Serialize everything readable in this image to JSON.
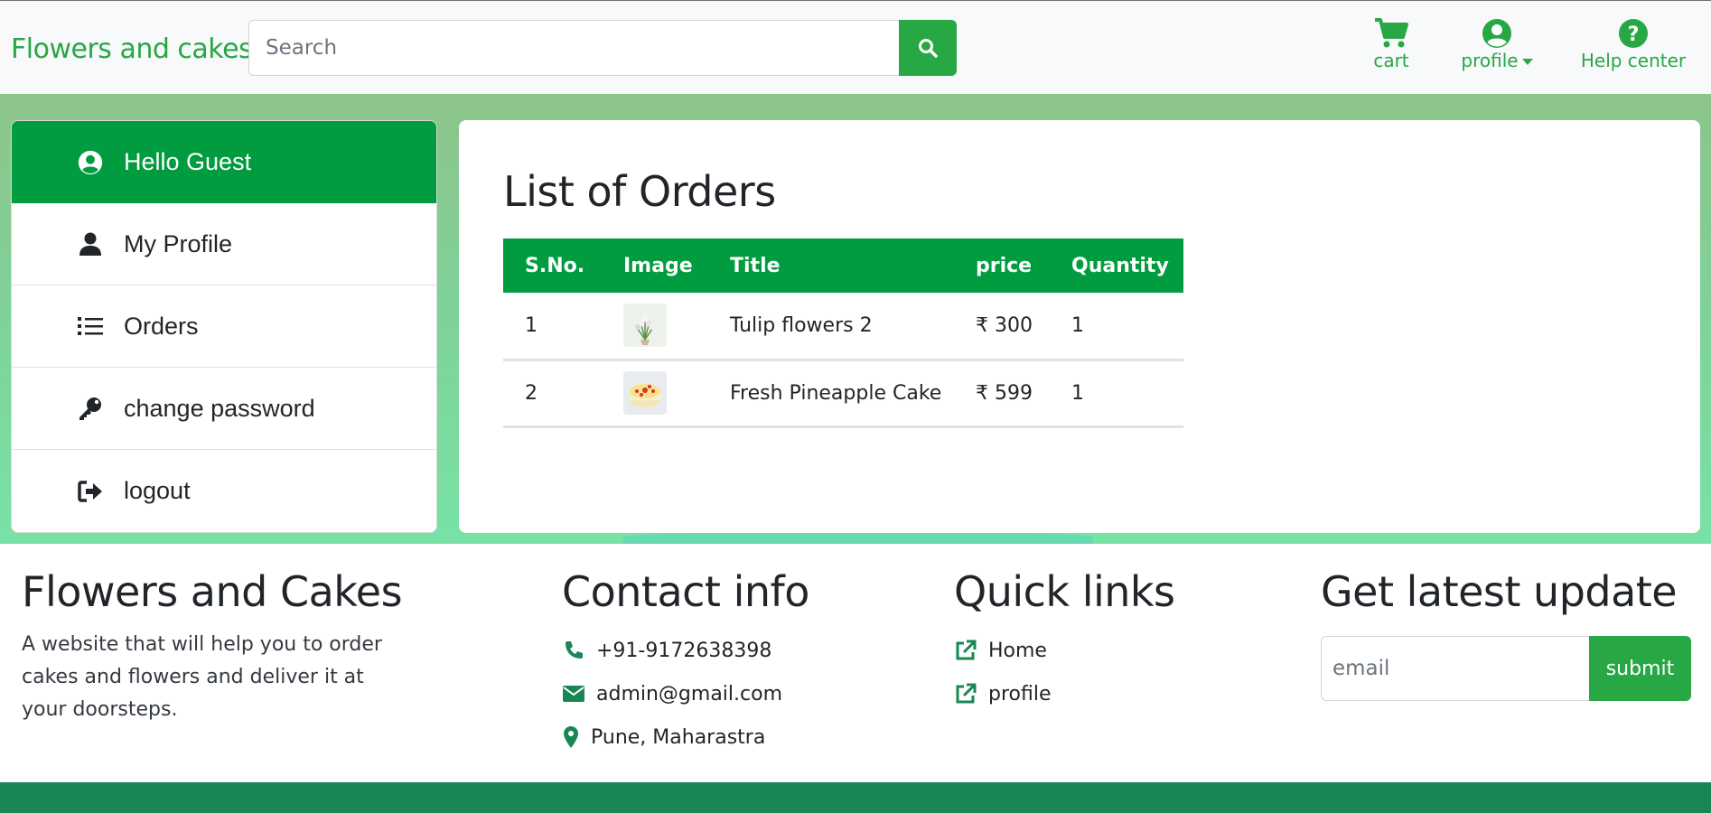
{
  "brand": "Flowers and cakes",
  "search": {
    "placeholder": "Search"
  },
  "nav": {
    "cart": "cart",
    "profile": "profile",
    "help": "Help center"
  },
  "sidebar": {
    "items": [
      {
        "label": "Hello Guest",
        "icon": "user-circle-icon",
        "active": true
      },
      {
        "label": "My Profile",
        "icon": "user-icon"
      },
      {
        "label": "Orders",
        "icon": "list-icon"
      },
      {
        "label": "change password",
        "icon": "key-icon"
      },
      {
        "label": "logout",
        "icon": "sign-out-icon"
      }
    ]
  },
  "orders": {
    "title": "List of Orders",
    "columns": [
      "S.No.",
      "Image",
      "Title",
      "price",
      "Quantity"
    ],
    "rows": [
      {
        "sno": "1",
        "image": "tulip-flowers-thumbnail",
        "title": "Tulip flowers 2",
        "price": "₹ 300",
        "quantity": "1"
      },
      {
        "sno": "2",
        "image": "pineapple-cake-thumbnail",
        "title": "Fresh Pineapple Cake",
        "price": "₹ 599",
        "quantity": "1"
      }
    ]
  },
  "footer": {
    "about": {
      "title": "Flowers and Cakes",
      "description": "A website that will help you to order cakes and flowers and deliver it at your doorsteps."
    },
    "contact": {
      "title": "Contact info",
      "phone": "+91-9172638398",
      "email": "admin@gmail.com",
      "address": "Pune, Maharastra"
    },
    "links": {
      "title": "Quick links",
      "items": [
        "Home",
        "profile"
      ]
    },
    "update": {
      "title": "Get latest update",
      "placeholder": "email",
      "button": "submit"
    }
  },
  "colors": {
    "accent": "#28a745",
    "table_header": "#009c3f",
    "bottom_bar": "#198754",
    "link_icon": "#198754"
  }
}
